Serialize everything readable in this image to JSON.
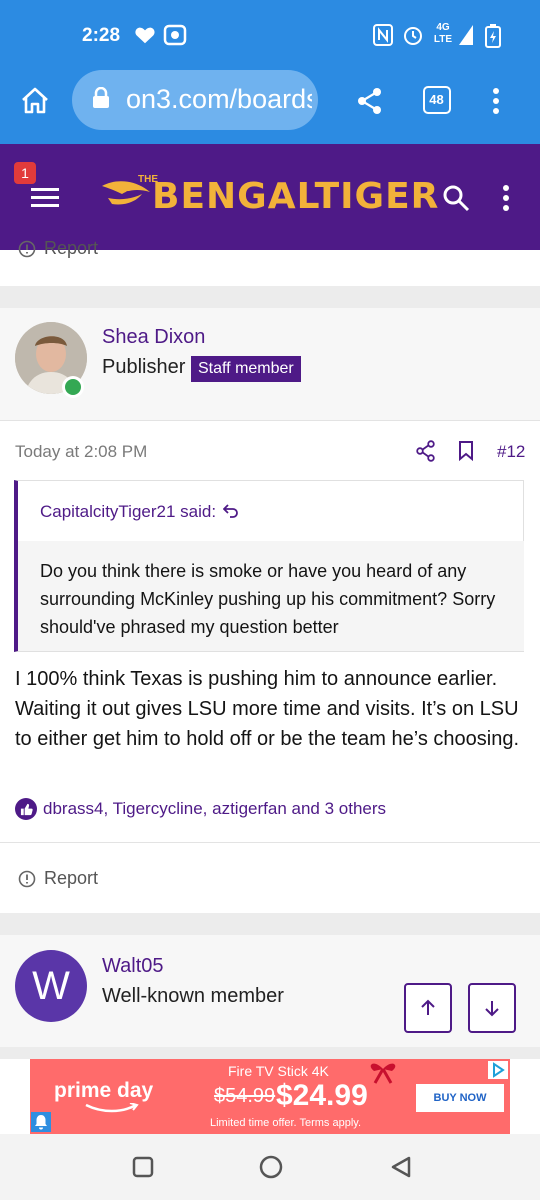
{
  "status_bar": {
    "time": "2:28",
    "network": "4G LTE"
  },
  "browser": {
    "url": "on3.com/boards",
    "tab_count": "48"
  },
  "site_header": {
    "notification_count": "1",
    "logo_the": "THE",
    "logo_bengal": "BENGAL",
    "logo_tiger": "TIGER"
  },
  "prev_post": {
    "report_label": "Report"
  },
  "post": {
    "author": "Shea Dixon",
    "author_title": "Publisher",
    "staff_badge": "Staff member",
    "timestamp": "Today at 2:08 PM",
    "post_number": "#12",
    "quote_author": "CapitalcityTiger21 said:",
    "quote_text": "Do you think there is smoke or have you heard of any surrounding McKinley pushing up his commitment? Sorry should've phrased my question better",
    "body": "I 100% think Texas is pushing him to announce earlier. Waiting it out gives LSU more time and visits. It’s on LSU to either get him to hold off or be the team he’s choosing.",
    "reactions": "dbrass4, Tigercycline, aztigerfan and 3 others",
    "report_label": "Report"
  },
  "next_post": {
    "avatar_letter": "W",
    "author": "Walt05",
    "author_title": "Well-known member"
  },
  "ad": {
    "brand": "prime day",
    "product": "Fire TV Stick 4K",
    "old_price": "$54.99",
    "new_price": "$24.99",
    "terms": "Limited time offer. Terms apply.",
    "cta": "BUY NOW"
  },
  "colors": {
    "primary": "#4e1a87",
    "browser_bar": "#2c8be2",
    "accent_gold": "#f2b23a"
  }
}
